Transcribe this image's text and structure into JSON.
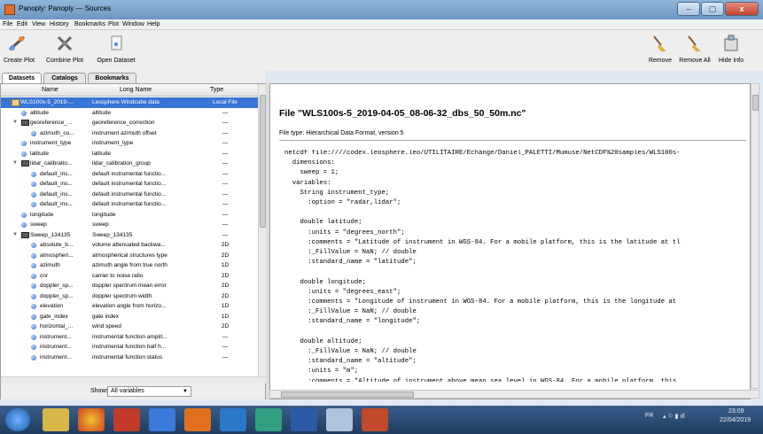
{
  "window": {
    "title": "Panoply: Panoply — Sources",
    "minimize": "–",
    "maximize": "▢",
    "close": "x"
  },
  "menu": [
    "File",
    "Edit",
    "View",
    "History",
    "Bookmarks",
    "Plot",
    "Window",
    "Help"
  ],
  "toolbar": {
    "create_plot": "Create Plot",
    "combine_plot": "Combine Plot",
    "open_dataset": "Open Dataset",
    "remove": "Remove",
    "remove_all": "Remove All",
    "hide_info": "Hide Info"
  },
  "tabs": [
    "Datasets",
    "Catalogs",
    "Bookmarks"
  ],
  "table": {
    "columns": [
      "Name",
      "Long Name",
      "Type"
    ],
    "rows": [
      {
        "name": "WLS100s-5_2019-...",
        "long": "Leosphere Windcube data",
        "type": "Local File",
        "kind": "dataset",
        "depth": 0,
        "expand": "▼"
      },
      {
        "name": "altitude",
        "long": "altitude",
        "type": "—",
        "kind": "var",
        "depth": 1,
        "expand": ""
      },
      {
        "name": "georeference_...",
        "long": "georeference_correction",
        "type": "—",
        "kind": "group",
        "depth": 1,
        "expand": "▼"
      },
      {
        "name": "azimuth_co...",
        "long": "instrument azimuth offset",
        "type": "—",
        "kind": "var",
        "depth": 2,
        "expand": ""
      },
      {
        "name": "instrument_type",
        "long": "instrument_type",
        "type": "—",
        "kind": "var",
        "depth": 1,
        "expand": ""
      },
      {
        "name": "latitude",
        "long": "latitude",
        "type": "—",
        "kind": "var",
        "depth": 1,
        "expand": ""
      },
      {
        "name": "lidar_calibratio...",
        "long": "lidar_calibration_group",
        "type": "—",
        "kind": "group",
        "depth": 1,
        "expand": "▼"
      },
      {
        "name": "default_ins...",
        "long": "default instrumental functio...",
        "type": "—",
        "kind": "var",
        "depth": 2,
        "expand": ""
      },
      {
        "name": "default_ins...",
        "long": "default instrumental functio...",
        "type": "—",
        "kind": "var",
        "depth": 2,
        "expand": ""
      },
      {
        "name": "default_ins...",
        "long": "default instrumental functio...",
        "type": "—",
        "kind": "var",
        "depth": 2,
        "expand": ""
      },
      {
        "name": "default_ins...",
        "long": "default instrumental functio...",
        "type": "—",
        "kind": "var",
        "depth": 2,
        "expand": ""
      },
      {
        "name": "longitude",
        "long": "longitude",
        "type": "—",
        "kind": "var",
        "depth": 1,
        "expand": ""
      },
      {
        "name": "sweep",
        "long": "sweep",
        "type": "—",
        "kind": "var",
        "depth": 1,
        "expand": ""
      },
      {
        "name": "Sweep_134135",
        "long": "Sweep_134135",
        "type": "—",
        "kind": "group",
        "depth": 1,
        "expand": "▼"
      },
      {
        "name": "absolute_b...",
        "long": "volume attenuated backwa...",
        "type": "2D",
        "kind": "var",
        "depth": 2,
        "expand": ""
      },
      {
        "name": "atmospheri...",
        "long": "atmospherical structures type",
        "type": "2D",
        "kind": "var",
        "depth": 2,
        "expand": ""
      },
      {
        "name": "azimuth",
        "long": "azimuth angle from true north",
        "type": "1D",
        "kind": "var",
        "depth": 2,
        "expand": ""
      },
      {
        "name": "cnr",
        "long": "carrier to noise ratio",
        "type": "2D",
        "kind": "var",
        "depth": 2,
        "expand": ""
      },
      {
        "name": "doppler_sp...",
        "long": "doppler spectrum mean error",
        "type": "2D",
        "kind": "var",
        "depth": 2,
        "expand": ""
      },
      {
        "name": "doppler_sp...",
        "long": "doppler spectrum width",
        "type": "2D",
        "kind": "var",
        "depth": 2,
        "expand": ""
      },
      {
        "name": "elevation",
        "long": "elevation angle from horizo...",
        "type": "1D",
        "kind": "var",
        "depth": 2,
        "expand": ""
      },
      {
        "name": "gate_index",
        "long": "gate index",
        "type": "1D",
        "kind": "var",
        "depth": 2,
        "expand": ""
      },
      {
        "name": "horizontal_...",
        "long": "wind speed",
        "type": "2D",
        "kind": "var",
        "depth": 2,
        "expand": ""
      },
      {
        "name": "instrument...",
        "long": "instrumental function amplit...",
        "type": "—",
        "kind": "var",
        "depth": 2,
        "expand": ""
      },
      {
        "name": "instrument...",
        "long": "instrumental function half h...",
        "type": "—",
        "kind": "var",
        "depth": 2,
        "expand": ""
      },
      {
        "name": "instrument...",
        "long": "instrumental function status",
        "type": "—",
        "kind": "var",
        "depth": 2,
        "expand": ""
      }
    ]
  },
  "show": {
    "label": "Shows:",
    "value": "All variables"
  },
  "info": {
    "title": "File \"WLS100s-5_2019-04-05_08-06-32_dbs_50_50m.nc\"",
    "filetype": "File type: Hierarchical Data Format, version 5",
    "code": [
      "netcdf file:////codex.leosphere.leo/UTILITAIRE/Echange/Daniel_PALETTI/Mumuse/NetCDF%20samples/WLS100s-",
      "  dimensions:",
      "    sweep = 1;",
      "  variables:",
      "    String instrument_type;",
      "      :option = \"radar,lidar\";",
      "",
      "    double latitude;",
      "      :units = \"degrees_north\";",
      "      :comments = \"Latitude of instrument in WGS-84. For a mobile platform, this is the latitude at tl",
      "      :_FillValue = NaN; // double",
      "      :standard_name = \"latitude\";",
      "",
      "    double longitude;",
      "      :units = \"degrees_east\";",
      "      :comments = \"Longitude of instrument in WGS-84. For a mobile platform, this is the longitude at",
      "      :_FillValue = NaN; // double",
      "      :standard_name = \"longitude\";",
      "",
      "    double altitude;",
      "      :_FillValue = NaN; // double",
      "      :standard_name = \"altitude\";",
      "      :units = \"m\";",
      "      :comments = \"Altitude of instrument above mean sea level in WGS-84. For a mobile platform, this"
    ]
  },
  "tray": {
    "time": "23:09",
    "date": "22/04/2019",
    "lang": "FR"
  },
  "colors": {
    "selected": "#3875d7",
    "taskbar": "#203c60"
  }
}
